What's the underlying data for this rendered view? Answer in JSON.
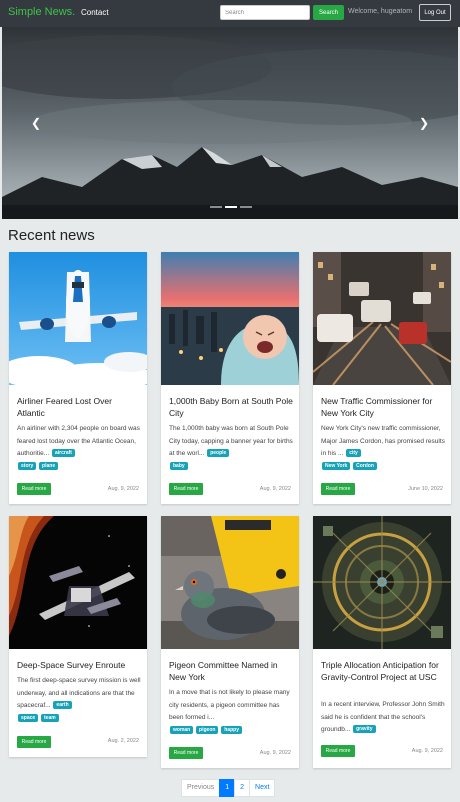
{
  "navbar": {
    "brand": "Simple News.",
    "contact_link": "Contact",
    "search_placeholder": "Search",
    "search_button": "Search",
    "welcome": "Welcome, hugeatom",
    "logout_button": "Log Out"
  },
  "section_title": "Recent news",
  "read_more_label": "Read more",
  "articles": [
    {
      "title": "Airliner Feared Lost Over Atlantic",
      "excerpt": "An airliner with 2,304 people on board was feared lost today over the Atlantic Ocean, authoritie...",
      "tags": [
        "aircraft",
        "story",
        "plane"
      ],
      "date": "Aug. 9, 2022"
    },
    {
      "title": "1,000th Baby Born at South Pole City",
      "excerpt": "The 1,000th baby was born at South Pole City today, capping a banner year for births at the worl...",
      "tags": [
        "people",
        "baby"
      ],
      "date": "Aug. 9, 2022"
    },
    {
      "title": "New Traffic Commissioner for New York City",
      "excerpt": "New York City's new traffic commissioner, Major James Cordon, has promised results in his ...",
      "tags": [
        "city",
        "New York",
        "Cordon"
      ],
      "date": "June 10, 2022"
    },
    {
      "title": "Deep-Space Survey Enroute",
      "excerpt": "The first deep-space survey mission is well underway, and all indications are that the spacecraf...",
      "tags": [
        "earth",
        "space",
        "team"
      ],
      "date": "Aug. 2, 2022"
    },
    {
      "title": "Pigeon Committee Named in New York",
      "excerpt": "In a move that is not likely to please many city residents, a pigeon committee has been formed i...",
      "tags": [
        "woman",
        "pigeon",
        "happy"
      ],
      "date": "Aug. 9, 2022"
    },
    {
      "title": "Triple Allocation Anticipation for Gravity-Control Project at USC",
      "excerpt": "In a recent interview, Professor John Smith said he is confident that the school's groundb...",
      "tags": [
        "gravity"
      ],
      "date": "Aug. 9, 2022"
    }
  ],
  "pagination": {
    "previous": "Previous",
    "pages": [
      "1",
      "2"
    ],
    "next": "Next",
    "current": "1"
  },
  "colors": {
    "navbar": "#343a40",
    "brand": "#3fc34a",
    "button_green": "#28a745",
    "tag": "#17a2b8",
    "page_active": "#007bff",
    "background": "#e6eaea"
  },
  "icons": {
    "carousel_prev": "chevron-left-icon",
    "carousel_next": "chevron-right-icon"
  }
}
